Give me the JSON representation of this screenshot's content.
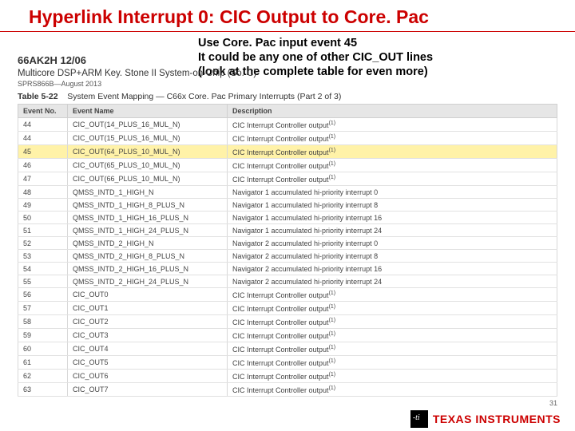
{
  "title": "Hyperlink Interrupt 0: CIC Output to Core. Pac",
  "note": {
    "line1": "Use Core. Pac input event 45",
    "line2": "It could be any one of other CIC_OUT lines",
    "line3": "(look at the complete table for even more)"
  },
  "docinfo": {
    "part": "66AK2H 12/06",
    "sub": "Multicore DSP+ARM Key. Stone II System-on-Chip (So. C)",
    "date": "SPRS866B—August 2013"
  },
  "caption": {
    "tnum": "Table 5-22",
    "txt": "System Event Mapping — C66x Core. Pac Primary Interrupts (Part 2 of 3)"
  },
  "columns": [
    "Event No.",
    "Event Name",
    "Description"
  ],
  "rows": [
    {
      "no": "44",
      "name": "CIC_OUT(14_PLUS_16_MUL_N)",
      "desc": "CIC Interrupt Controller output",
      "sup": "(1)",
      "hl": false
    },
    {
      "no": "44",
      "name": "CIC_OUT(15_PLUS_16_MUL_N)",
      "desc": "CIC Interrupt Controller output",
      "sup": "(1)",
      "hl": false
    },
    {
      "no": "45",
      "name": "CIC_OUT(64_PLUS_10_MUL_N)",
      "desc": "CIC Interrupt Controller output",
      "sup": "(1)",
      "hl": true
    },
    {
      "no": "46",
      "name": "CIC_OUT(65_PLUS_10_MUL_N)",
      "desc": "CIC Interrupt Controller output",
      "sup": "(1)",
      "hl": false
    },
    {
      "no": "47",
      "name": "CIC_OUT(66_PLUS_10_MUL_N)",
      "desc": "CIC Interrupt Controller output",
      "sup": "(1)",
      "hl": false
    },
    {
      "no": "48",
      "name": "QMSS_INTD_1_HIGH_N",
      "desc": "Navigator 1 accumulated hi-priority interrupt 0",
      "sup": "",
      "hl": false
    },
    {
      "no": "49",
      "name": "QMSS_INTD_1_HIGH_8_PLUS_N",
      "desc": "Navigator 1 accumulated hi-priority interrupt 8",
      "sup": "",
      "hl": false
    },
    {
      "no": "50",
      "name": "QMSS_INTD_1_HIGH_16_PLUS_N",
      "desc": "Navigator 1 accumulated hi-priority interrupt 16",
      "sup": "",
      "hl": false
    },
    {
      "no": "51",
      "name": "QMSS_INTD_1_HIGH_24_PLUS_N",
      "desc": "Navigator 1 accumulated hi-priority interrupt 24",
      "sup": "",
      "hl": false
    },
    {
      "no": "52",
      "name": "QMSS_INTD_2_HIGH_N",
      "desc": "Navigator 2 accumulated hi-priority interrupt 0",
      "sup": "",
      "hl": false
    },
    {
      "no": "53",
      "name": "QMSS_INTD_2_HIGH_8_PLUS_N",
      "desc": "Navigator 2 accumulated hi-priority interrupt 8",
      "sup": "",
      "hl": false
    },
    {
      "no": "54",
      "name": "QMSS_INTD_2_HIGH_16_PLUS_N",
      "desc": "Navigator 2 accumulated hi-priority interrupt 16",
      "sup": "",
      "hl": false
    },
    {
      "no": "55",
      "name": "QMSS_INTD_2_HIGH_24_PLUS_N",
      "desc": "Navigator 2 accumulated hi-priority interrupt 24",
      "sup": "",
      "hl": false
    },
    {
      "no": "56",
      "name": "CIC_OUT0",
      "desc": "CIC Interrupt Controller output",
      "sup": "(1)",
      "hl": false
    },
    {
      "no": "57",
      "name": "CIC_OUT1",
      "desc": "CIC Interrupt Controller output",
      "sup": "(1)",
      "hl": false
    },
    {
      "no": "58",
      "name": "CIC_OUT2",
      "desc": "CIC Interrupt Controller output",
      "sup": "(1)",
      "hl": false
    },
    {
      "no": "59",
      "name": "CIC_OUT3",
      "desc": "CIC Interrupt Controller output",
      "sup": "(1)",
      "hl": false
    },
    {
      "no": "60",
      "name": "CIC_OUT4",
      "desc": "CIC Interrupt Controller output",
      "sup": "(1)",
      "hl": false
    },
    {
      "no": "61",
      "name": "CIC_OUT5",
      "desc": "CIC Interrupt Controller output",
      "sup": "(1)",
      "hl": false
    },
    {
      "no": "62",
      "name": "CIC_OUT6",
      "desc": "CIC Interrupt Controller output",
      "sup": "(1)",
      "hl": false
    },
    {
      "no": "63",
      "name": "CIC_OUT7",
      "desc": "CIC Interrupt Controller output",
      "sup": "(1)",
      "hl": false
    }
  ],
  "pagenum": "31",
  "footer": {
    "brand": "TEXAS INSTRUMENTS"
  }
}
